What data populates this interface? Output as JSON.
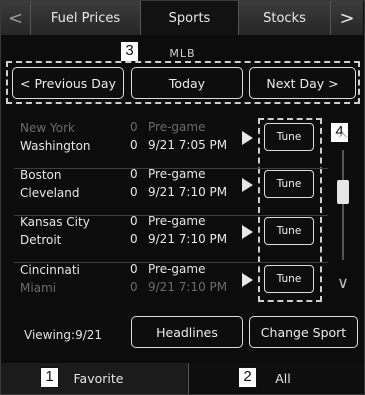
{
  "tabs": {
    "prev_arrow": "<",
    "items": [
      {
        "label": "Fuel Prices"
      },
      {
        "label": "Sports"
      },
      {
        "label": "Stocks"
      }
    ],
    "next_arrow": ">"
  },
  "section_label": "MLB",
  "day_nav": {
    "previous": "< Previous Day",
    "today": "Today",
    "next": "Next Day >"
  },
  "games": [
    {
      "team1": "New York",
      "team2": "Washington",
      "score1": "0",
      "score2": "0",
      "status1": "Pre-game",
      "status2": "9/21 7:05 PM",
      "tune": "Tune"
    },
    {
      "team1": "Boston",
      "team2": "Cleveland",
      "score1": "0",
      "score2": "0",
      "status1": "Pre-game",
      "status2": "9/21 7:10 PM",
      "tune": "Tune"
    },
    {
      "team1": "Kansas City",
      "team2": "Detroit",
      "score1": "0",
      "score2": "0",
      "status1": "Pre-game",
      "status2": "9/21 7:10 PM",
      "tune": "Tune"
    },
    {
      "team1": "Cincinnati",
      "team2": "Miami",
      "score1": "0",
      "score2": "0",
      "status1": "Pre-game",
      "status2": "9/21 7:10 PM",
      "tune": "Tune"
    }
  ],
  "scroll": {
    "up": "^",
    "down": "∨"
  },
  "viewing": "Viewing:9/21",
  "buttons": {
    "headlines": "Headlines",
    "change_sport": "Change Sport"
  },
  "bottom_tabs": {
    "favorite": "Favorite",
    "all": "All"
  },
  "callouts": {
    "one": "1",
    "two": "2",
    "three": "3",
    "four": "4"
  }
}
